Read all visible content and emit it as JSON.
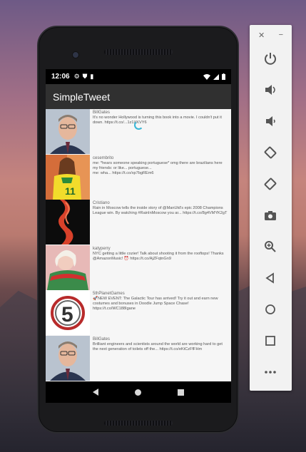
{
  "status_bar": {
    "time": "12:06"
  },
  "app_bar": {
    "title": "SimpleTweet"
  },
  "tweets": [
    {
      "user": "BillGates",
      "text": "It's no wonder Hollywood is turning this book into a movie. I couldn't put it down. https://t.co/...1z1XKVY6"
    },
    {
      "user": "cesembrito",
      "text": "me: *hears someone speaking portuguese* omg there are brazilians here\nmy friends: or like... portuguese...\nme: wha... https://t.co/xp7bgREm6"
    },
    {
      "user": "Cristiano",
      "text": "Rain in Moscow tells the inside story of @ManUtd's epic 2008 Champions League win. By watching #RainInMoscow you ar... https://t.co/8g4VMYK2gT"
    },
    {
      "user": "katyperry",
      "text": "NYC getting a little cozier! Talk about shooting it from the rooftops! Thanks @AmazonMusic! ⏰ https://t.co/AjZFqtnGn9"
    },
    {
      "user": "5thPlanetGames",
      "text": "🚀NEW EVENT: The Galactic Tour has arrived! Try it out and earn new costumes and bonuses in Doodle Jump Space Chase! https://t.co/WC188Igane"
    },
    {
      "user": "BillGates",
      "text": "Brilliant engineers and scientists around the world are working hard to get the next generation of toilets off the... https://t.co/eKtCzFfFHm"
    }
  ],
  "toolbar": {
    "close_glyph": "✕",
    "minimize_glyph": "−",
    "buttons": [
      "power-icon",
      "volume-up-icon",
      "volume-down-icon",
      "rotate-left-icon",
      "rotate-right-icon",
      "camera-icon",
      "zoom-icon",
      "back-icon",
      "home-icon",
      "overview-icon",
      "more-icon"
    ]
  }
}
